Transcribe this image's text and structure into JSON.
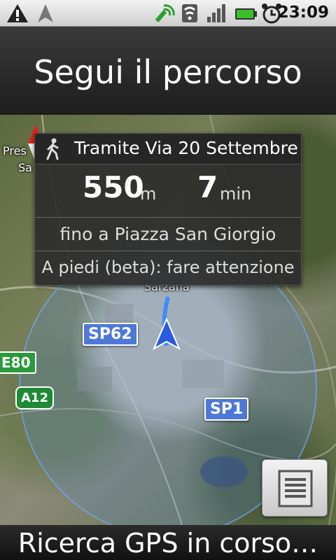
{
  "status_bar": {
    "time": "23:09",
    "icons": [
      "warning-icon",
      "navigation-icon",
      "gps-satellite-icon",
      "wifi-icon",
      "signal-icon",
      "battery-icon",
      "alarm-icon"
    ]
  },
  "header": {
    "title": "Segui il percorso"
  },
  "directions": {
    "step_icon": "walking-person-icon",
    "step_text": "Tramite Via 20 Settembre",
    "distance_value": "550",
    "distance_unit": "m",
    "time_value": "7",
    "time_unit": "min",
    "destination": "fino a Piazza San Giorgio",
    "warning": "A piedi (beta): fare attenzione"
  },
  "map": {
    "road_labels": {
      "sp62": "SP62",
      "sp1": "SP1",
      "e80": "E80",
      "a12": "A12"
    },
    "place_labels": {
      "town": "Sarzana",
      "left_top": "Pres",
      "left_second": "Sa"
    },
    "accent_color": "#4d78d8"
  },
  "menu_button": {
    "icon": "menu-list-icon"
  },
  "footer": {
    "status": "Ricerca GPS in corso…"
  }
}
